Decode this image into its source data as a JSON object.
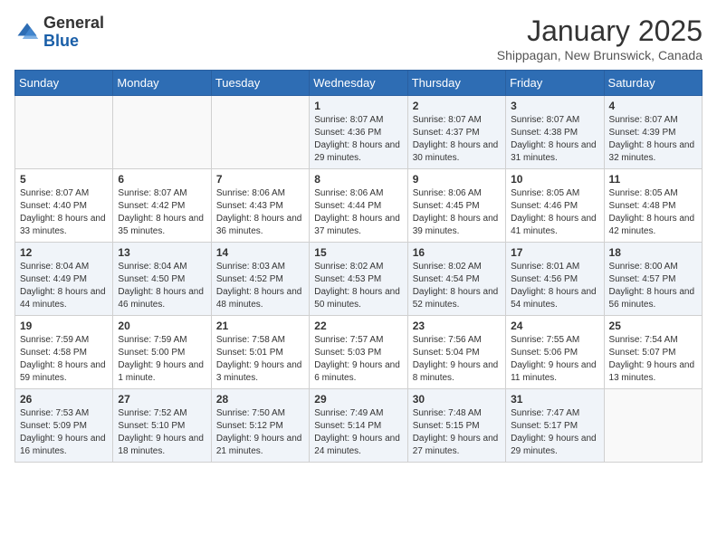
{
  "header": {
    "logo_general": "General",
    "logo_blue": "Blue",
    "month_title": "January 2025",
    "location": "Shippagan, New Brunswick, Canada"
  },
  "weekdays": [
    "Sunday",
    "Monday",
    "Tuesday",
    "Wednesday",
    "Thursday",
    "Friday",
    "Saturday"
  ],
  "weeks": [
    [
      {
        "day": "",
        "content": ""
      },
      {
        "day": "",
        "content": ""
      },
      {
        "day": "",
        "content": ""
      },
      {
        "day": "1",
        "content": "Sunrise: 8:07 AM\nSunset: 4:36 PM\nDaylight: 8 hours and 29 minutes."
      },
      {
        "day": "2",
        "content": "Sunrise: 8:07 AM\nSunset: 4:37 PM\nDaylight: 8 hours and 30 minutes."
      },
      {
        "day": "3",
        "content": "Sunrise: 8:07 AM\nSunset: 4:38 PM\nDaylight: 8 hours and 31 minutes."
      },
      {
        "day": "4",
        "content": "Sunrise: 8:07 AM\nSunset: 4:39 PM\nDaylight: 8 hours and 32 minutes."
      }
    ],
    [
      {
        "day": "5",
        "content": "Sunrise: 8:07 AM\nSunset: 4:40 PM\nDaylight: 8 hours and 33 minutes."
      },
      {
        "day": "6",
        "content": "Sunrise: 8:07 AM\nSunset: 4:42 PM\nDaylight: 8 hours and 35 minutes."
      },
      {
        "day": "7",
        "content": "Sunrise: 8:06 AM\nSunset: 4:43 PM\nDaylight: 8 hours and 36 minutes."
      },
      {
        "day": "8",
        "content": "Sunrise: 8:06 AM\nSunset: 4:44 PM\nDaylight: 8 hours and 37 minutes."
      },
      {
        "day": "9",
        "content": "Sunrise: 8:06 AM\nSunset: 4:45 PM\nDaylight: 8 hours and 39 minutes."
      },
      {
        "day": "10",
        "content": "Sunrise: 8:05 AM\nSunset: 4:46 PM\nDaylight: 8 hours and 41 minutes."
      },
      {
        "day": "11",
        "content": "Sunrise: 8:05 AM\nSunset: 4:48 PM\nDaylight: 8 hours and 42 minutes."
      }
    ],
    [
      {
        "day": "12",
        "content": "Sunrise: 8:04 AM\nSunset: 4:49 PM\nDaylight: 8 hours and 44 minutes."
      },
      {
        "day": "13",
        "content": "Sunrise: 8:04 AM\nSunset: 4:50 PM\nDaylight: 8 hours and 46 minutes."
      },
      {
        "day": "14",
        "content": "Sunrise: 8:03 AM\nSunset: 4:52 PM\nDaylight: 8 hours and 48 minutes."
      },
      {
        "day": "15",
        "content": "Sunrise: 8:02 AM\nSunset: 4:53 PM\nDaylight: 8 hours and 50 minutes."
      },
      {
        "day": "16",
        "content": "Sunrise: 8:02 AM\nSunset: 4:54 PM\nDaylight: 8 hours and 52 minutes."
      },
      {
        "day": "17",
        "content": "Sunrise: 8:01 AM\nSunset: 4:56 PM\nDaylight: 8 hours and 54 minutes."
      },
      {
        "day": "18",
        "content": "Sunrise: 8:00 AM\nSunset: 4:57 PM\nDaylight: 8 hours and 56 minutes."
      }
    ],
    [
      {
        "day": "19",
        "content": "Sunrise: 7:59 AM\nSunset: 4:58 PM\nDaylight: 8 hours and 59 minutes."
      },
      {
        "day": "20",
        "content": "Sunrise: 7:59 AM\nSunset: 5:00 PM\nDaylight: 9 hours and 1 minute."
      },
      {
        "day": "21",
        "content": "Sunrise: 7:58 AM\nSunset: 5:01 PM\nDaylight: 9 hours and 3 minutes."
      },
      {
        "day": "22",
        "content": "Sunrise: 7:57 AM\nSunset: 5:03 PM\nDaylight: 9 hours and 6 minutes."
      },
      {
        "day": "23",
        "content": "Sunrise: 7:56 AM\nSunset: 5:04 PM\nDaylight: 9 hours and 8 minutes."
      },
      {
        "day": "24",
        "content": "Sunrise: 7:55 AM\nSunset: 5:06 PM\nDaylight: 9 hours and 11 minutes."
      },
      {
        "day": "25",
        "content": "Sunrise: 7:54 AM\nSunset: 5:07 PM\nDaylight: 9 hours and 13 minutes."
      }
    ],
    [
      {
        "day": "26",
        "content": "Sunrise: 7:53 AM\nSunset: 5:09 PM\nDaylight: 9 hours and 16 minutes."
      },
      {
        "day": "27",
        "content": "Sunrise: 7:52 AM\nSunset: 5:10 PM\nDaylight: 9 hours and 18 minutes."
      },
      {
        "day": "28",
        "content": "Sunrise: 7:50 AM\nSunset: 5:12 PM\nDaylight: 9 hours and 21 minutes."
      },
      {
        "day": "29",
        "content": "Sunrise: 7:49 AM\nSunset: 5:14 PM\nDaylight: 9 hours and 24 minutes."
      },
      {
        "day": "30",
        "content": "Sunrise: 7:48 AM\nSunset: 5:15 PM\nDaylight: 9 hours and 27 minutes."
      },
      {
        "day": "31",
        "content": "Sunrise: 7:47 AM\nSunset: 5:17 PM\nDaylight: 9 hours and 29 minutes."
      },
      {
        "day": "",
        "content": ""
      }
    ]
  ]
}
